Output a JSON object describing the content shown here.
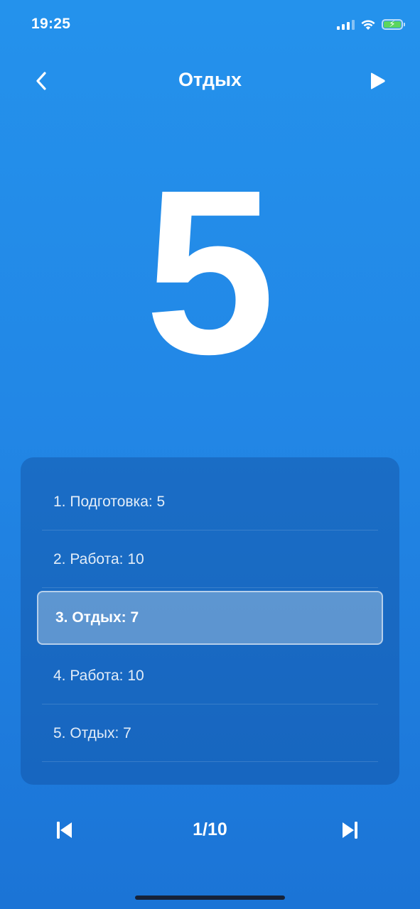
{
  "status_bar": {
    "time": "19:25",
    "icons": [
      "signal-icon",
      "wifi-icon",
      "battery-charging-icon"
    ]
  },
  "header": {
    "title": "Отдых",
    "back_icon": "chevron-left-icon",
    "play_icon": "play-icon"
  },
  "timer": {
    "value": "5"
  },
  "intervals": {
    "items": [
      {
        "label": "1. Подготовка: 5",
        "selected": false
      },
      {
        "label": "2. Работа: 10",
        "selected": false
      },
      {
        "label": "3. Отдых: 7",
        "selected": true
      },
      {
        "label": "4. Работа: 10",
        "selected": false
      },
      {
        "label": "5. Отдых: 7",
        "selected": false
      }
    ]
  },
  "footer": {
    "progress": "1/10",
    "prev_icon": "skip-previous-icon",
    "next_icon": "skip-next-icon"
  },
  "colors": {
    "background_top": "#2492ec",
    "background_bottom": "#1b74d6",
    "text": "#ffffff",
    "battery_charge": "#5bd55f"
  }
}
